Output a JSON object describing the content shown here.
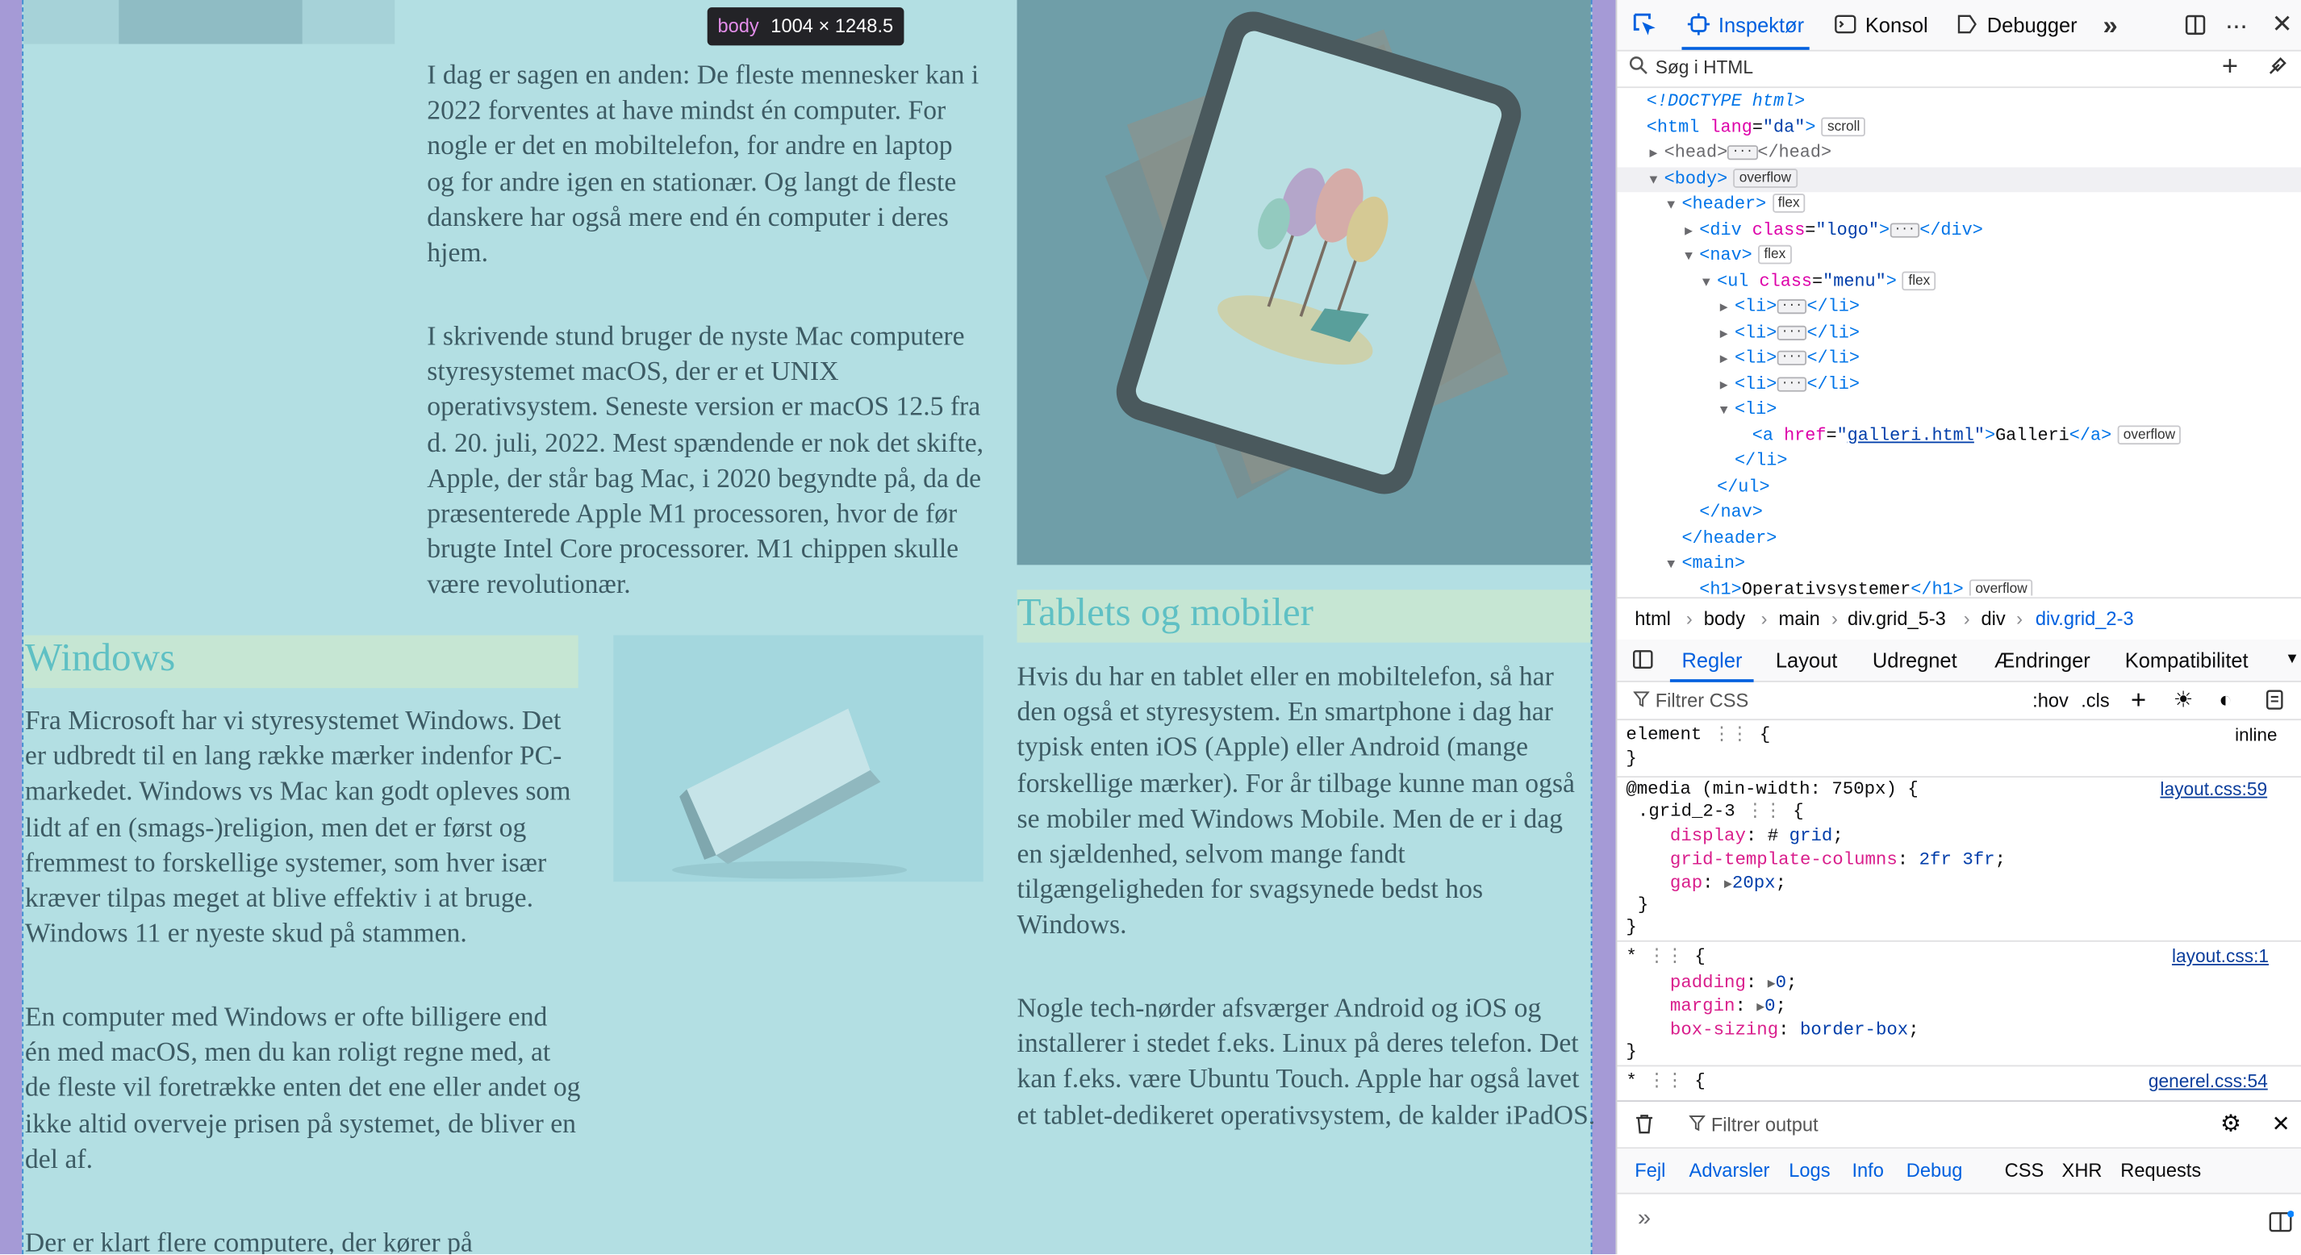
{
  "tooltip": {
    "tag": "body",
    "size": "1004 × 1248.5"
  },
  "article": {
    "para_mac_1": [
      "I dag er sagen en anden: De fleste mennesker kan i",
      "2022 forventes at have mindst én computer. For",
      "nogle er det en mobiltelefon, for andre en laptop",
      "og for andre igen en stationær. Og langt de fleste",
      "danskere har også mere end én computer i deres",
      "hjem."
    ],
    "para_mac_2": [
      "I skrivende stund bruger de nyste Mac computere",
      "styresystemet macOS, der er et UNIX",
      "operativsystem. Seneste version er macOS 12.5 fra",
      "d. 20. juli, 2022. Mest spændende er nok det skifte,",
      "Apple, der står bag Mac, i 2020 begyndte på, da de",
      "præsenterede Apple M1 processoren, hvor de før",
      "brugte Intel Core processorer. M1 chippen skulle",
      "være revolutionær."
    ],
    "windows_heading": "Windows",
    "para_win_1": [
      "Fra Microsoft har vi styresystemet Windows. Det",
      "er udbredt til en lang række mærker indenfor PC-",
      "markedet. Windows vs Mac kan godt opleves som",
      "lidt af en (smags-)religion, men det er først og",
      "fremmest to forskellige systemer, som hver især",
      "kræver tilpas meget at blive effektiv i at bruge.",
      "Windows 11 er nyeste skud på stammen."
    ],
    "para_win_2": [
      "En computer med Windows er ofte billigere end",
      "én med macOS, men du kan roligt regne med, at",
      "de fleste vil foretrække enten det ene eller andet og",
      "ikke altid overveje prisen på systemet, de bliver en",
      "del af."
    ],
    "para_win_3": [
      "Der er klart flere computere, der kører på"
    ],
    "tablets_heading": "Tablets og mobiler",
    "para_tab_1": [
      "Hvis du har en tablet eller en mobiltelefon, så har",
      "den også et styresystem. En smartphone i dag har",
      "typisk enten iOS (Apple) eller Android (mange",
      "forskellige mærker). For år tilbage kunne man også",
      "se mobiler med Windows Mobile. Men de er i dag",
      "en sjældenhed, selvom mange fandt",
      "tilgængeligheden for svagsynede bedst hos",
      "Windows."
    ],
    "para_tab_2": [
      "Nogle tech-nørder afsværger Android og iOS og",
      "installerer i stedet f.eks. Linux på deres telefon. Det",
      "kan f.eks. være Ubuntu Touch. Apple har også lavet",
      "et tablet-dedikeret operativsystem, de kalder iPadOS."
    ]
  },
  "devtools": {
    "toolbar": {
      "inspector": "Inspektør",
      "console": "Konsol",
      "debugger": "Debugger"
    },
    "search_placeholder": "Søg i HTML",
    "tree": {
      "doctype": "<!DOCTYPE html>",
      "html_lang": "\"da\"",
      "badge_scroll": "scroll",
      "badge_overflow": "overflow",
      "badge_flex": "flex",
      "logo_class": "\"logo\"",
      "menu_class": "\"menu\"",
      "galleri_href": "galleri.html",
      "galleri_text": "Galleri",
      "h1_text": "Operativsystemer"
    },
    "breadcrumbs": [
      "html",
      "body",
      "main",
      "div.grid_5-3",
      "div",
      "div.grid_2-3"
    ],
    "rule_tabs": [
      "Regler",
      "Layout",
      "Udregnet",
      "Ændringer",
      "Kompatibilitet"
    ],
    "filter_css": "Filtrer CSS",
    "pseudo": ":hov",
    "cls": ".cls",
    "rules": {
      "element_selector": "element",
      "element_source": "inline",
      "media_query": "@media (min-width: 750px) {",
      "media_source": "layout.css:59",
      "grid_selector": ".grid_2-3",
      "grid_props": [
        {
          "name": "display",
          "value": "grid"
        },
        {
          "name": "grid-template-columns",
          "value": "2fr 3fr"
        },
        {
          "name": "gap",
          "value": "20px"
        }
      ],
      "star_source_1": "layout.css:1",
      "star_props": [
        {
          "name": "padding",
          "value": "0"
        },
        {
          "name": "margin",
          "value": "0"
        },
        {
          "name": "box-sizing",
          "value": "border-box"
        }
      ],
      "star_source_2": "generel.css:54"
    },
    "console": {
      "filter_output": "Filtrer output",
      "filters": [
        "Fejl",
        "Advarsler",
        "Logs",
        "Info",
        "Debug",
        "CSS",
        "XHR",
        "Requests"
      ]
    }
  }
}
